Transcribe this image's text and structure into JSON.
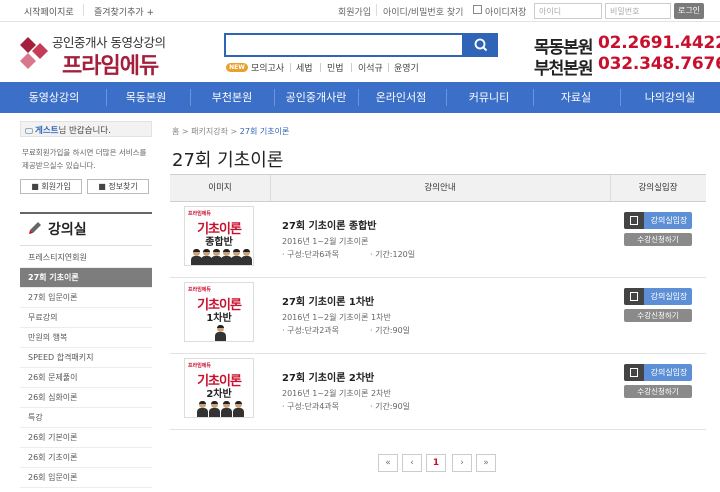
{
  "topbar": {
    "home_label": "시작페이지로",
    "bookmark_label": "즐겨찾기추가 +",
    "join_label": "회원가입",
    "find_label": "아이디/비밀번호 찾기",
    "save_id_label": "아이디저장",
    "id_placeholder": "아이디",
    "pw_placeholder": "비밀번호",
    "login_label": "로그인"
  },
  "header": {
    "logo_small": "공인중개사 동영상강의",
    "logo_big": "프라임에듀",
    "search_placeholder": "",
    "hot_badge": "NEW",
    "hot_keywords": [
      "모의고사",
      "세법",
      "민법",
      "이석규",
      "윤영기"
    ],
    "branches": [
      {
        "name": "목동본원",
        "phone": "02.2691.4422"
      },
      {
        "name": "부천본원",
        "phone": "032.348.7676"
      }
    ]
  },
  "nav": {
    "items": [
      "동영상강의",
      "목동본원",
      "부천본원",
      "공인중개사란",
      "온라인서점",
      "커뮤니티",
      "자료실",
      "나의강의실"
    ]
  },
  "sidebar": {
    "welcome_user": "게스트",
    "welcome_suffix": "님 반갑습니다.",
    "welcome_text": "무료회원가입을 하시면 더많은 서비스를 제공받으실수 있습니다.",
    "join_button": "회원가입",
    "find_button": "정보찾기",
    "section_title": "강의실",
    "items": [
      {
        "label": "프레스티지연회원",
        "active": false
      },
      {
        "label": "27회 기초이론",
        "active": true
      },
      {
        "label": "27회 입문이론",
        "active": false
      },
      {
        "label": "무료강의",
        "active": false
      },
      {
        "label": "만원의 행복",
        "active": false
      },
      {
        "label": "SPEED 합격패키지",
        "active": false
      },
      {
        "label": "26회 문제풀이",
        "active": false
      },
      {
        "label": "26회 심화이론",
        "active": false
      },
      {
        "label": "특강",
        "active": false
      },
      {
        "label": "26회 기본이론",
        "active": false
      },
      {
        "label": "26회 기초이론",
        "active": false
      },
      {
        "label": "26회 입문이론",
        "active": false
      }
    ]
  },
  "main": {
    "breadcrumb": [
      "홈",
      "패키지강좌",
      "27회 기초이론"
    ],
    "title": "27회 기초이론",
    "columns": [
      "이미지",
      "강의안내",
      "강의실입장"
    ],
    "courses": [
      {
        "thumb_brand": "프라임에듀",
        "thumb_title": "기초이론",
        "thumb_sub": "종합반",
        "title": "27회 기초이론 종합반",
        "subtitle": "2016년 1~2월 기초이론",
        "meta_a": "· 구성:단과6과목",
        "meta_b": "· 기간:120일",
        "enter_label": "강의실입장",
        "apply_label": "수강신청하기"
      },
      {
        "thumb_brand": "프라임에듀",
        "thumb_title": "기초이론",
        "thumb_sub": "1차반",
        "title": "27회 기초이론 1차반",
        "subtitle": "2016년 1~2월 기초이론 1차반",
        "meta_a": "· 구성:단과2과목",
        "meta_b": "· 기간:90일",
        "enter_label": "강의실입장",
        "apply_label": "수강신청하기"
      },
      {
        "thumb_brand": "프라임에듀",
        "thumb_title": "기초이론",
        "thumb_sub": "2차반",
        "title": "27회 기초이론 2차반",
        "subtitle": "2016년 1~2월 기초이론 2차반",
        "meta_a": "· 구성:단과4과목",
        "meta_b": "· 기간:90일",
        "enter_label": "강의실입장",
        "apply_label": "수강신청하기"
      }
    ]
  },
  "pagination": {
    "first": "«",
    "prev": "‹",
    "current": "1",
    "next": "›",
    "last": "»"
  },
  "colors": {
    "nav_blue": "#3b6fc8",
    "brand_red": "#c8102e",
    "logo_red": "#a41f3b",
    "button_blue": "#5d8fd6"
  }
}
